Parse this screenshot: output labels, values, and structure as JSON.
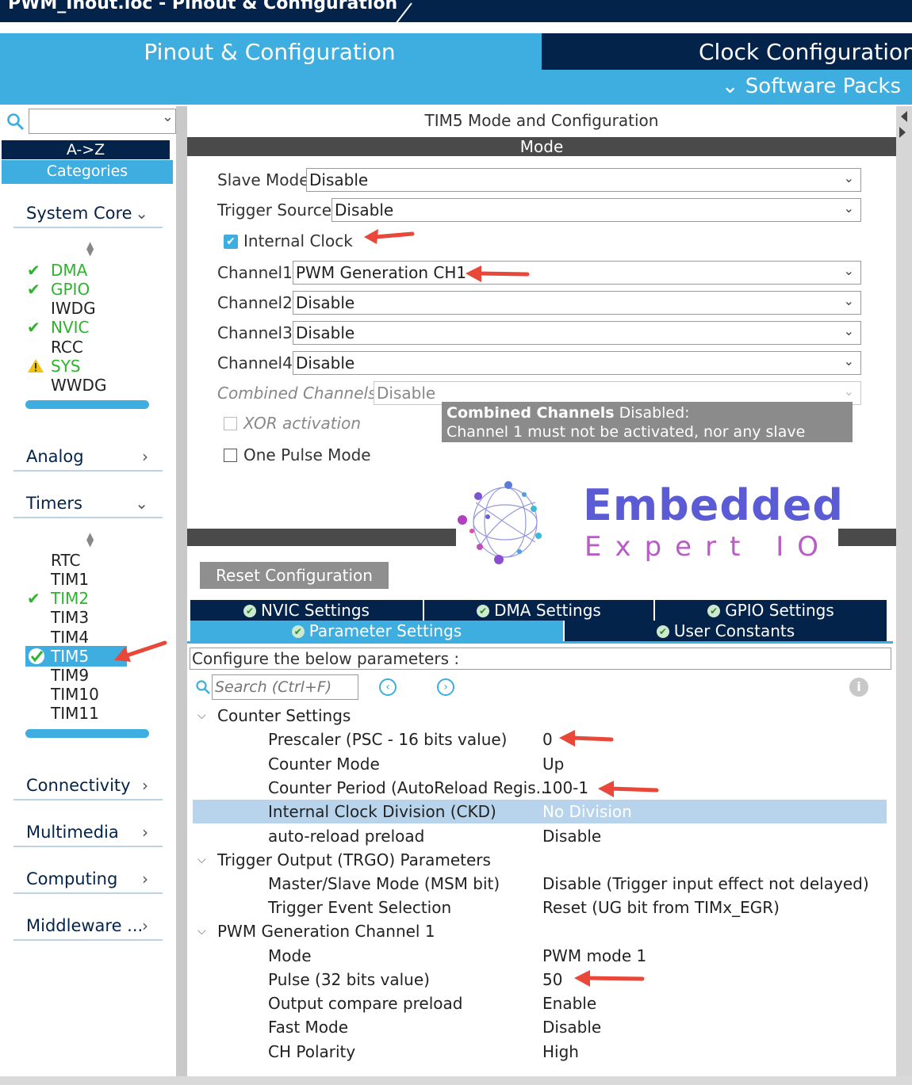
{
  "window": {
    "title": "PWM_Inout.ioc - Pinout & Configuration"
  },
  "tabs": {
    "pinout": "Pinout & Configuration",
    "clock": "Clock Configuration",
    "software_packs": "Software Packs"
  },
  "sidebar": {
    "sort_az": "A->Z",
    "categories": "Categories",
    "sections": {
      "system_core": "System Core",
      "analog": "Analog",
      "timers": "Timers",
      "connectivity": "Connectivity",
      "multimedia": "Multimedia",
      "computing": "Computing",
      "middleware": "Middleware ..."
    },
    "system_core_items": [
      {
        "label": "DMA",
        "status": "ok"
      },
      {
        "label": "GPIO",
        "status": "ok"
      },
      {
        "label": "IWDG",
        "status": "none"
      },
      {
        "label": "NVIC",
        "status": "ok"
      },
      {
        "label": "RCC",
        "status": "none"
      },
      {
        "label": "SYS",
        "status": "warning"
      },
      {
        "label": "WWDG",
        "status": "none"
      }
    ],
    "timers_items": [
      {
        "label": "RTC",
        "status": "none"
      },
      {
        "label": "TIM1",
        "status": "none"
      },
      {
        "label": "TIM2",
        "status": "ok"
      },
      {
        "label": "TIM3",
        "status": "none"
      },
      {
        "label": "TIM4",
        "status": "none"
      },
      {
        "label": "TIM5",
        "status": "selected"
      },
      {
        "label": "TIM9",
        "status": "none"
      },
      {
        "label": "TIM10",
        "status": "none"
      },
      {
        "label": "TIM11",
        "status": "none"
      }
    ]
  },
  "mode": {
    "panel_title": "TIM5 Mode and Configuration",
    "header": "Mode",
    "slave_mode": {
      "label": "Slave Mode",
      "value": "Disable"
    },
    "trigger_source": {
      "label": "Trigger Source",
      "value": "Disable"
    },
    "internal_clock": {
      "label": "Internal Clock",
      "checked": true
    },
    "channel1": {
      "label": "Channel1",
      "value": "PWM Generation CH1"
    },
    "channel2": {
      "label": "Channel2",
      "value": "Disable"
    },
    "channel3": {
      "label": "Channel3",
      "value": "Disable"
    },
    "channel4": {
      "label": "Channel4",
      "value": "Disable"
    },
    "combined": {
      "label": "Combined Channels",
      "value": "Disable"
    },
    "xor": {
      "label": "XOR activation"
    },
    "one_pulse": {
      "label": "One Pulse Mode"
    },
    "tooltip": {
      "bold": "Combined Channels",
      "line1_rest": " Disabled:",
      "line2": "Channel 1 must not be activated, nor any slave mode"
    }
  },
  "logo": {
    "line1": "Embedded",
    "line2": "Expert IO"
  },
  "config": {
    "reset_button": "Reset Configuration",
    "tabs": {
      "nvic": "NVIC Settings",
      "dma": "DMA Settings",
      "gpio": "GPIO Settings",
      "params": "Parameter Settings",
      "user": "User Constants"
    },
    "configure_label": "Configure the below parameters :",
    "search_placeholder": "Search (Ctrl+F)",
    "rows": [
      {
        "type": "group",
        "key": "Counter Settings",
        "value": ""
      },
      {
        "type": "item",
        "key": "Prescaler (PSC - 16 bits value)",
        "value": "0"
      },
      {
        "type": "item",
        "key": "Counter Mode",
        "value": "Up"
      },
      {
        "type": "item",
        "key": "Counter Period (AutoReload Regis...",
        "value": "100-1"
      },
      {
        "type": "item",
        "key": "Internal Clock Division (CKD)",
        "value": "No Division"
      },
      {
        "type": "item",
        "key": "auto-reload preload",
        "value": "Disable"
      },
      {
        "type": "group",
        "key": "Trigger Output (TRGO) Parameters",
        "value": ""
      },
      {
        "type": "item",
        "key": "Master/Slave Mode (MSM bit)",
        "value": "Disable (Trigger input effect not delayed)"
      },
      {
        "type": "item",
        "key": "Trigger Event Selection",
        "value": "Reset (UG bit from TIMx_EGR)"
      },
      {
        "type": "group",
        "key": "PWM Generation Channel 1",
        "value": ""
      },
      {
        "type": "item",
        "key": "Mode",
        "value": "PWM mode 1"
      },
      {
        "type": "item",
        "key": "Pulse (32 bits value)",
        "value": "50"
      },
      {
        "type": "item",
        "key": "Output compare preload",
        "value": "Enable"
      },
      {
        "type": "item",
        "key": "Fast Mode",
        "value": "Disable"
      },
      {
        "type": "item",
        "key": "CH Polarity",
        "value": "High"
      }
    ]
  },
  "colors": {
    "navy": "#03234b",
    "accent": "#3eaddf",
    "ok": "#2cb52c",
    "arrow": "#e8473a"
  }
}
